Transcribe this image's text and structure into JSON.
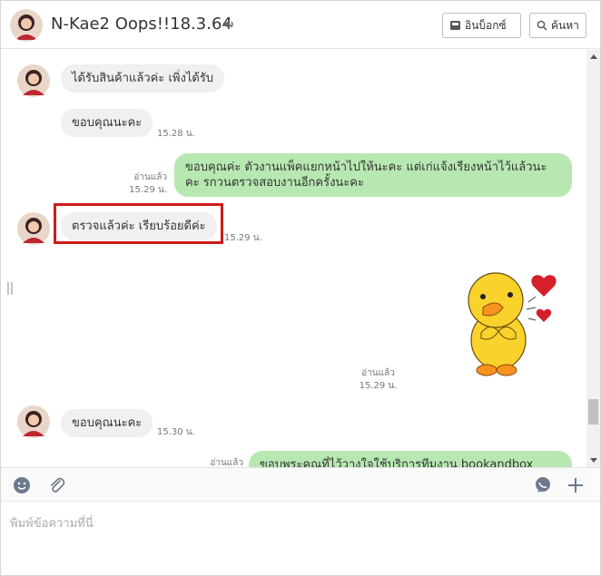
{
  "header": {
    "title": "N-Kae2 Oops!!18.3.64",
    "inbox_label": "อินบ็อกซ์",
    "search_label": "ค้นหา"
  },
  "messages": [
    {
      "side": "in",
      "text": "ได้รับสินค้าแล้วค่ะ เพิ่งได้รับ",
      "time": ""
    },
    {
      "side": "in",
      "text": "ขอบคุณนะคะ",
      "time": "15.28 น."
    },
    {
      "side": "out",
      "text": "ขอบคุณค่ะ ตัวงานแพ็คแยกหน้าไปให้นะคะ แต่เก่แจ้งเรียงหน้าไว้แล้วนะคะ รกวนตรวจสอบงานอีกครั้งนะคะ",
      "read": "อ่านแล้ว",
      "time": "15.29 น."
    },
    {
      "side": "in",
      "text": "ตรวจแล้วค่ะ เรียบร้อยดีค่ะ",
      "time": "15.29 น.",
      "highlighted": true
    },
    {
      "side": "out",
      "type": "sticker",
      "sticker": "yellow-duck-heart-sticker",
      "read": "อ่านแล้ว",
      "time": "15.29 น."
    },
    {
      "side": "in",
      "text": "ขอบคุณนะคะ",
      "time": "15.30 น."
    },
    {
      "side": "out",
      "text": "ขอบพระคุณที่ไว้วางใจใช้บริการทีมงาน bookandbox นะคะ",
      "read": "อ่านแล้ว",
      "time": ""
    }
  ],
  "composer": {
    "placeholder": "พิมพ์ข้อความที่นี่"
  },
  "colors": {
    "outgoing_bubble": "#b8e8b2",
    "incoming_bubble": "#f0f0f3",
    "highlight_box": "#d01a1a"
  },
  "icons": {
    "speaker": "speaker-icon",
    "inbox": "inbox-icon",
    "search": "search-icon",
    "emoji": "emoji-icon",
    "attach": "paperclip-icon",
    "chat": "chat-bubble-icon",
    "add": "plus-icon"
  }
}
